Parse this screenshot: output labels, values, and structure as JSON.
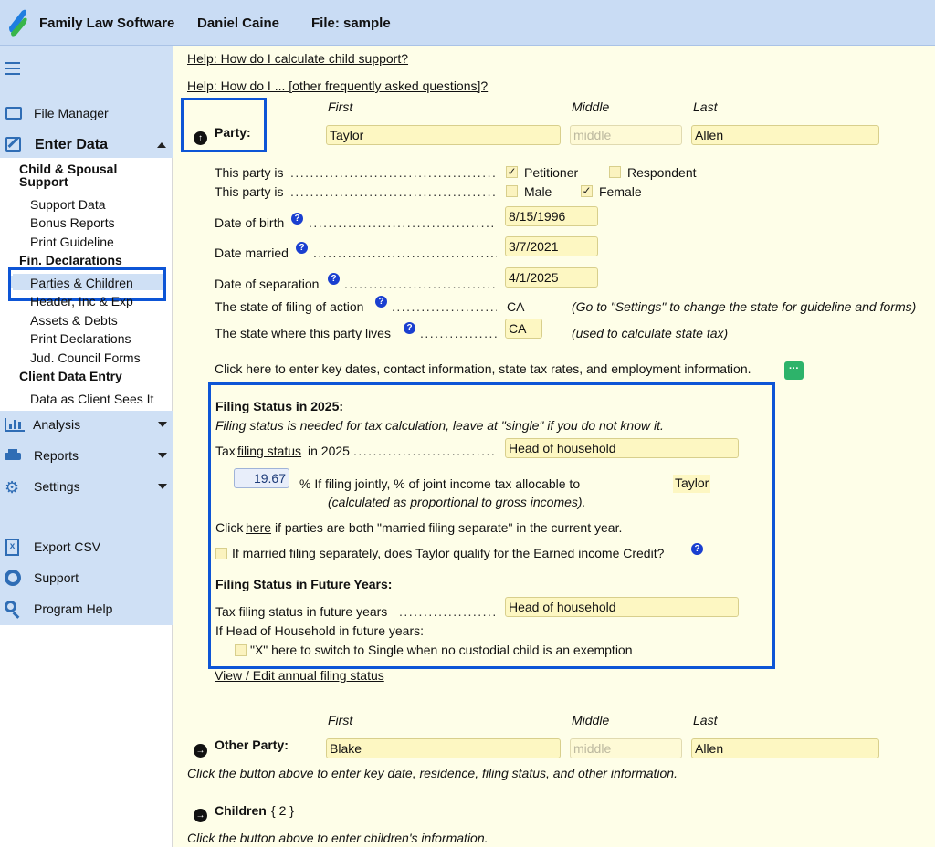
{
  "topbar": {
    "app_name": "Family Law Software",
    "user": "Daniel Caine",
    "file": "File: sample"
  },
  "sidebar": {
    "file_manager": "File Manager",
    "enter_data": "Enter Data",
    "child_spousal": "Child & Spousal",
    "support": "Support",
    "support_data": "Support Data",
    "bonus_reports": "Bonus Reports",
    "print_guideline": "Print Guideline",
    "fin_declarations": "Fin. Declarations",
    "parties_children": "Parties & Children",
    "header_inc_exp": "Header, Inc & Exp",
    "assets_debts": "Assets & Debts",
    "print_declarations": "Print Declarations",
    "jud_council_forms": "Jud. Council Forms",
    "client_data_entry": "Client Data Entry",
    "data_as_client": "Data as Client Sees It",
    "analysis": "Analysis",
    "reports": "Reports",
    "settings": "Settings",
    "export_csv": "Export CSV",
    "support_link": "Support",
    "program_help": "Program Help"
  },
  "help_links": {
    "child_support": "Help: How do I calculate child support?",
    "faq": "Help: How do I ... [other frequently asked questions]?"
  },
  "party": {
    "label": "Party:",
    "first_header": "First",
    "middle_header": "Middle",
    "last_header": "Last",
    "first": "Taylor",
    "middle_placeholder": "middle",
    "last": "Allen",
    "this_party_is_1": "This party is",
    "petitioner": "Petitioner",
    "respondent": "Respondent",
    "petitioner_checked": true,
    "respondent_checked": false,
    "this_party_is_2": "This party is",
    "male": "Male",
    "female": "Female",
    "male_checked": false,
    "female_checked": true,
    "dob_label": "Date of birth",
    "dob": "8/15/1996",
    "married_label": "Date married",
    "married": "3/7/2021",
    "separation_label": "Date of separation",
    "separation": "4/1/2025",
    "state_filing_label": "The state of filing of action",
    "state_filing": "CA",
    "state_filing_note": "(Go to \"Settings\" to change the state for guideline and forms)",
    "state_lives_label": "The state where this party lives",
    "state_lives": "CA",
    "state_lives_note": "(used to calculate state tax)",
    "key_dates_text": "Click here to enter key dates, contact information, state tax rates, and employment information."
  },
  "filing": {
    "title": "Filing Status in 2025:",
    "note": "Filing status is needed for tax calculation, leave at \"single\" if you do not know it.",
    "tax_pre": "Tax",
    "tax_link": "filing status",
    "tax_post": "in 2025",
    "status_2025": "Head of household",
    "joint_pct": "19.67",
    "joint_text": "% If filing jointly, % of joint income tax allocable to",
    "joint_name": "Taylor",
    "joint_note": "(calculated as proportional to gross incomes).",
    "click_pre": "Click",
    "click_here": "here",
    "click_post": "if parties are both \"married filing separate\" in the current year.",
    "eic_text": "If married filing separately, does Taylor qualify for the Earned income Credit?",
    "future_title": "Filing Status in Future Years:",
    "future_label": "Tax filing status in future years",
    "future_status": "Head of household",
    "hoh_text": "If Head of Household in future years:",
    "x_text": "\"X\" here to switch to Single when no custodial child is an exemption",
    "view_edit": "View / Edit annual filing status"
  },
  "other_party": {
    "label": "Other Party:",
    "first_header": "First",
    "middle_header": "Middle",
    "last_header": "Last",
    "first": "Blake",
    "middle_placeholder": "middle",
    "last": "Allen",
    "note": "Click the button above to enter key date, residence, filing status, and other information."
  },
  "children": {
    "label": "Children",
    "count": "{ 2 }",
    "note": "Click the button above to enter children's information."
  },
  "colors": {
    "accent": "#0d55d6",
    "topbar": "#c9dcf4",
    "field": "#fdf7c2",
    "page": "#fefee8"
  }
}
